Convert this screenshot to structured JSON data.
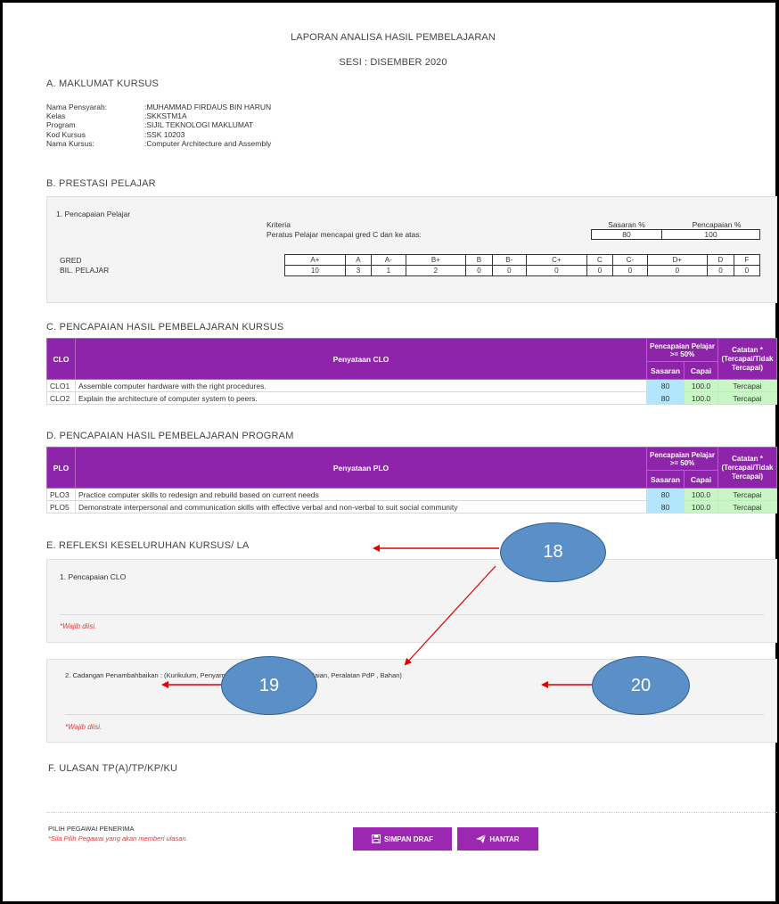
{
  "header": {
    "title": "LAPORAN ANALISA HASIL PEMBELAJARAN",
    "session": "SESI : DISEMBER 2020"
  },
  "section_a": {
    "title": "A. MAKLUMAT KURSUS",
    "fields": [
      {
        "label": "Nama Pensyarah:",
        "value": ":MUHAMMAD FIRDAUS BIN HARUN"
      },
      {
        "label": "Kelas",
        "value": ":SKKSTM1A"
      },
      {
        "label": "Program",
        "value": ":SIJIL TEKNOLOGI MAKLUMAT"
      },
      {
        "label": "Kod Kursus",
        "value": ":SSK 10203"
      },
      {
        "label": "Nama Kursus:",
        "value": ":Computer Architecture and Assembly"
      }
    ]
  },
  "section_b": {
    "title": "B. PRESTASI PELAJAR",
    "subtitle": "1. Pencapaian Pelajar",
    "kriteria_label": "Kriteria",
    "kriteria_text": "Peratus Pelajar mencapai gred C dan ke atas:",
    "sasaran_label": "Sasaran %",
    "pencapaian_label": "Pencapaian %",
    "sasaran_value": "80",
    "pencapaian_value": "100",
    "gred_label": "GRED",
    "bil_label": "BIL. PELAJAR",
    "grades": [
      "A+",
      "A",
      "A-",
      "B+",
      "B",
      "B-",
      "C+",
      "C",
      "C-",
      "D+",
      "D",
      "F"
    ],
    "counts": [
      "10",
      "3",
      "1",
      "2",
      "0",
      "0",
      "0",
      "0",
      "0",
      "0",
      "0",
      "0"
    ]
  },
  "section_c": {
    "title": "C. PENCAPAIAN HASIL PEMBELAJARAN KURSUS",
    "col_code": "CLO",
    "col_stmt": "Penyataan CLO",
    "col_pencapaian": "Pencapaian Pelajar >= 50%",
    "col_sasaran": "Sasaran",
    "col_capai": "Capai",
    "col_catatan": "Catatan * (Tercapai/Tidak Tercapai)",
    "rows": [
      {
        "code": "CLO1",
        "stmt": "Assemble computer hardware with the right procedures.",
        "sasaran": "80",
        "capai": "100.0",
        "catatan": "Tercapai"
      },
      {
        "code": "CLO2",
        "stmt": "Explain the architecture of computer system to peers.",
        "sasaran": "80",
        "capai": "100.0",
        "catatan": "Tercapai"
      }
    ]
  },
  "section_d": {
    "title": "D. PENCAPAIAN HASIL PEMBELAJARAN PROGRAM",
    "col_code": "PLO",
    "col_stmt": "Penyataan PLO",
    "col_pencapaian": "Pencapaian Pelajar >= 50%",
    "col_sasaran": "Sasaran",
    "col_capai": "Capai",
    "col_catatan": "Catatan * (Tercapai/Tidak Tercapai)",
    "rows": [
      {
        "code": "PLO3",
        "stmt": "Practice computer skills to redesign and rebuild based on current needs",
        "sasaran": "80",
        "capai": "100.0",
        "catatan": "Tercapai"
      },
      {
        "code": "PLO5",
        "stmt": "Demonstrate interpersonal and communication skills with effective verbal and non-verbal to suit social community",
        "sasaran": "80",
        "capai": "100.0",
        "catatan": "Tercapai"
      }
    ]
  },
  "section_e": {
    "title": "E. REFLEKSI KESELURUHAN KURSUS/ LA",
    "q1_label": "1. Pencapaian CLO",
    "q2_label": "2. Cadangan Penambahbaikan : (Kurikulum, Penyampaian PdP , Pentaksiran/Penilaian, Peralatan PdP , Bahan)",
    "required": "*Wajib diisi."
  },
  "section_f": {
    "title": "F. ULASAN TP(A)/TP/KP/KU",
    "recipient_label": "PILIH PEGAWAI PENERIMA",
    "recipient_hint": "*Sila Pilih Pegawai yang akan memberi ulasan.",
    "save_label": "SIMPAN DRAF",
    "send_label": "HANTAR"
  },
  "callouts": {
    "c18": "18",
    "c19": "19",
    "c20": "20"
  },
  "colors": {
    "header_purple": "#8e24aa",
    "button_purple": "#9c27b0",
    "sasaran_blue": "#b3e5fc",
    "capai_green": "#c8f7c5",
    "required_red": "#e53935",
    "callout_blue": "#5b8fc7"
  }
}
